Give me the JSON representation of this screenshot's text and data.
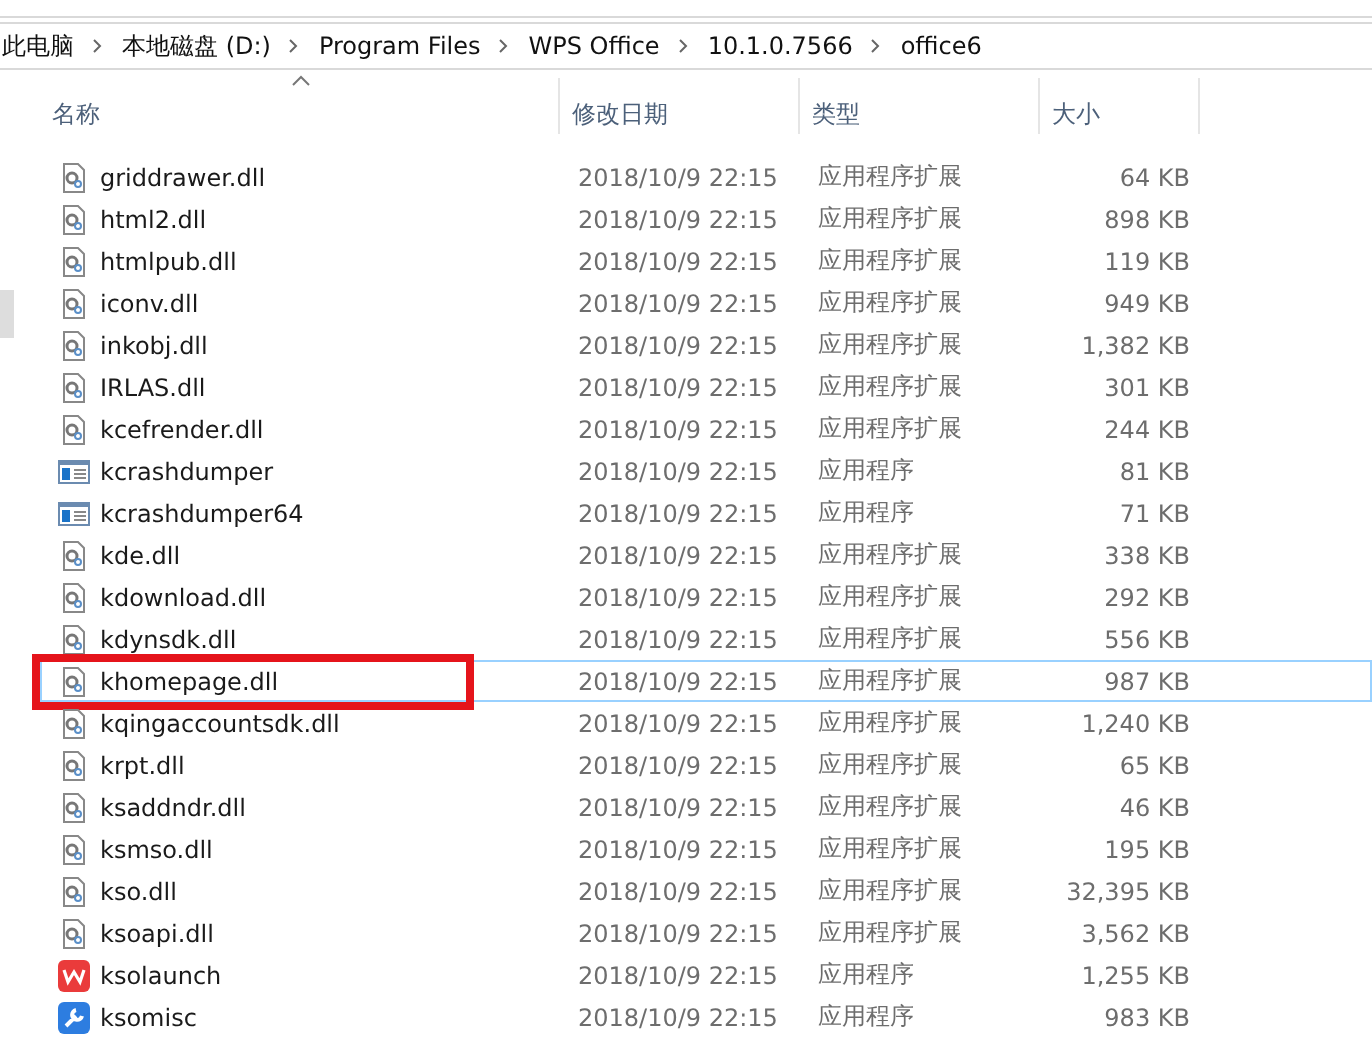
{
  "breadcrumb": [
    "此电脑",
    "本地磁盘 (D:)",
    "Program Files",
    "WPS Office",
    "10.1.0.7566",
    "office6"
  ],
  "columns": [
    {
      "label": "名称",
      "sorted": true
    },
    {
      "label": "修改日期",
      "sorted": false
    },
    {
      "label": "类型",
      "sorted": false
    },
    {
      "label": "大小",
      "sorted": false
    }
  ],
  "files": [
    {
      "kind": "dll",
      "name": "griddrawer.dll",
      "date": "2018/10/9 22:15",
      "type": "应用程序扩展",
      "size": "64 KB",
      "hovered": false,
      "highlighted": false
    },
    {
      "kind": "dll",
      "name": "html2.dll",
      "date": "2018/10/9 22:15",
      "type": "应用程序扩展",
      "size": "898 KB",
      "hovered": false,
      "highlighted": false
    },
    {
      "kind": "dll",
      "name": "htmlpub.dll",
      "date": "2018/10/9 22:15",
      "type": "应用程序扩展",
      "size": "119 KB",
      "hovered": false,
      "highlighted": false
    },
    {
      "kind": "dll",
      "name": "iconv.dll",
      "date": "2018/10/9 22:15",
      "type": "应用程序扩展",
      "size": "949 KB",
      "hovered": false,
      "highlighted": false
    },
    {
      "kind": "dll",
      "name": "inkobj.dll",
      "date": "2018/10/9 22:15",
      "type": "应用程序扩展",
      "size": "1,382 KB",
      "hovered": false,
      "highlighted": false
    },
    {
      "kind": "dll",
      "name": "IRLAS.dll",
      "date": "2018/10/9 22:15",
      "type": "应用程序扩展",
      "size": "301 KB",
      "hovered": false,
      "highlighted": false
    },
    {
      "kind": "dll",
      "name": "kcefrender.dll",
      "date": "2018/10/9 22:15",
      "type": "应用程序扩展",
      "size": "244 KB",
      "hovered": false,
      "highlighted": false
    },
    {
      "kind": "exe",
      "name": "kcrashdumper",
      "date": "2018/10/9 22:15",
      "type": "应用程序",
      "size": "81 KB",
      "hovered": false,
      "highlighted": false
    },
    {
      "kind": "exe",
      "name": "kcrashdumper64",
      "date": "2018/10/9 22:15",
      "type": "应用程序",
      "size": "71 KB",
      "hovered": false,
      "highlighted": false
    },
    {
      "kind": "dll",
      "name": "kde.dll",
      "date": "2018/10/9 22:15",
      "type": "应用程序扩展",
      "size": "338 KB",
      "hovered": false,
      "highlighted": false
    },
    {
      "kind": "dll",
      "name": "kdownload.dll",
      "date": "2018/10/9 22:15",
      "type": "应用程序扩展",
      "size": "292 KB",
      "hovered": false,
      "highlighted": false
    },
    {
      "kind": "dll",
      "name": "kdynsdk.dll",
      "date": "2018/10/9 22:15",
      "type": "应用程序扩展",
      "size": "556 KB",
      "hovered": false,
      "highlighted": false
    },
    {
      "kind": "dll",
      "name": "khomepage.dll",
      "date": "2018/10/9 22:15",
      "type": "应用程序扩展",
      "size": "987 KB",
      "hovered": true,
      "highlighted": true
    },
    {
      "kind": "dll",
      "name": "kqingaccountsdk.dll",
      "date": "2018/10/9 22:15",
      "type": "应用程序扩展",
      "size": "1,240 KB",
      "hovered": false,
      "highlighted": false
    },
    {
      "kind": "dll",
      "name": "krpt.dll",
      "date": "2018/10/9 22:15",
      "type": "应用程序扩展",
      "size": "65 KB",
      "hovered": false,
      "highlighted": false
    },
    {
      "kind": "dll",
      "name": "ksaddndr.dll",
      "date": "2018/10/9 22:15",
      "type": "应用程序扩展",
      "size": "46 KB",
      "hovered": false,
      "highlighted": false
    },
    {
      "kind": "dll",
      "name": "ksmso.dll",
      "date": "2018/10/9 22:15",
      "type": "应用程序扩展",
      "size": "195 KB",
      "hovered": false,
      "highlighted": false
    },
    {
      "kind": "dll",
      "name": "kso.dll",
      "date": "2018/10/9 22:15",
      "type": "应用程序扩展",
      "size": "32,395 KB",
      "hovered": false,
      "highlighted": false
    },
    {
      "kind": "dll",
      "name": "ksoapi.dll",
      "date": "2018/10/9 22:15",
      "type": "应用程序扩展",
      "size": "3,562 KB",
      "hovered": false,
      "highlighted": false
    },
    {
      "kind": "wps",
      "name": "ksolaunch",
      "date": "2018/10/9 22:15",
      "type": "应用程序",
      "size": "1,255 KB",
      "hovered": false,
      "highlighted": false
    },
    {
      "kind": "tool",
      "name": "ksomisc",
      "date": "2018/10/9 22:15",
      "type": "应用程序",
      "size": "983 KB",
      "hovered": false,
      "highlighted": false
    }
  ]
}
